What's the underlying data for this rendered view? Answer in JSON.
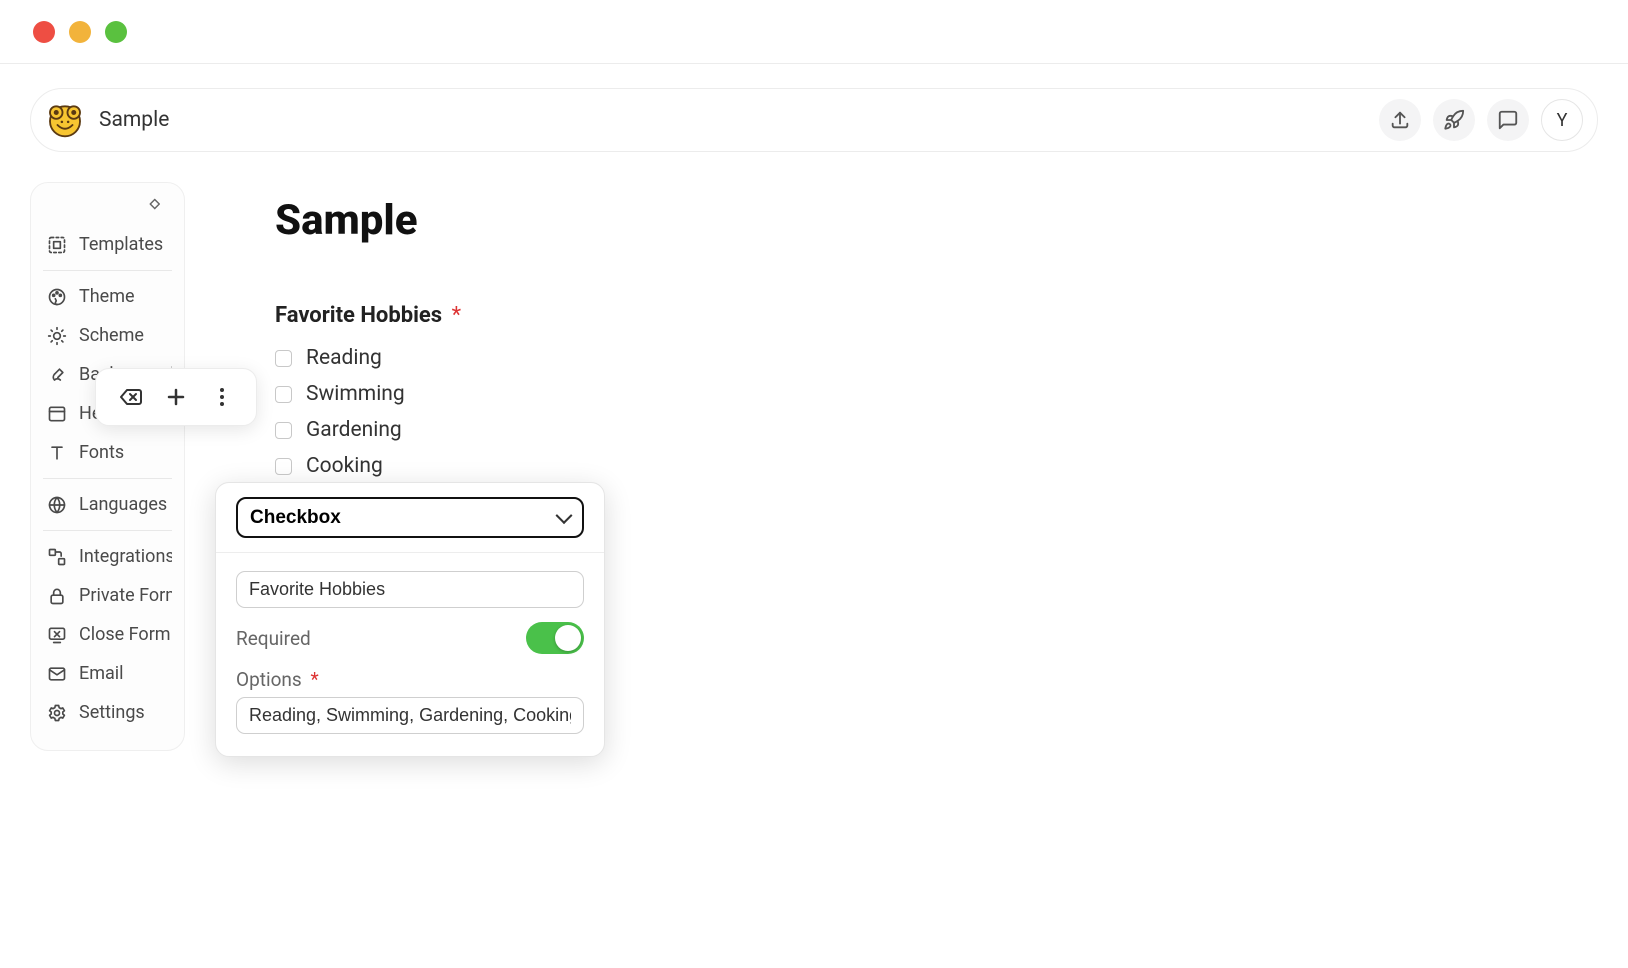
{
  "header": {
    "title": "Sample",
    "avatar_initial": "Y"
  },
  "sidebar": {
    "items": [
      {
        "label": "Templates"
      },
      {
        "label": "Theme"
      },
      {
        "label": "Scheme"
      },
      {
        "label": "Background"
      },
      {
        "label": "Header"
      },
      {
        "label": "Fonts"
      },
      {
        "label": "Languages"
      },
      {
        "label": "Integrations"
      },
      {
        "label": "Private Form"
      },
      {
        "label": "Close Form"
      },
      {
        "label": "Email"
      },
      {
        "label": "Settings"
      }
    ]
  },
  "form": {
    "title": "Sample",
    "field_label": "Favorite Hobbies",
    "required_marker": "*",
    "options": [
      "Reading",
      "Swimming",
      "Gardening",
      "Cooking"
    ]
  },
  "config": {
    "field_type": "Checkbox",
    "field_name": "Favorite Hobbies",
    "required_label": "Required",
    "required_on": true,
    "options_label": "Options",
    "options_marker": "*",
    "options_value": "Reading, Swimming, Gardening, Cooking"
  }
}
